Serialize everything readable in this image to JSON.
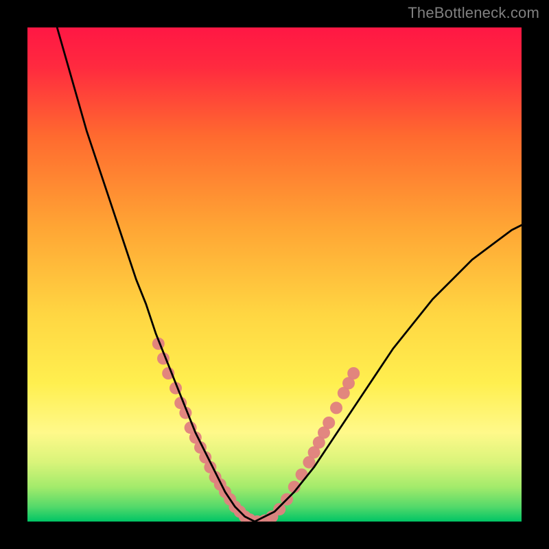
{
  "watermark": "TheBottleneck.com",
  "chart_data": {
    "type": "line",
    "title": "",
    "xlabel": "",
    "ylabel": "",
    "xlim": [
      0,
      100
    ],
    "ylim": [
      0,
      100
    ],
    "background_gradient": {
      "stops": [
        {
          "offset": 0.0,
          "color": "#ff1744"
        },
        {
          "offset": 0.08,
          "color": "#ff2a3f"
        },
        {
          "offset": 0.22,
          "color": "#ff6a2f"
        },
        {
          "offset": 0.4,
          "color": "#ffa434"
        },
        {
          "offset": 0.58,
          "color": "#ffd642"
        },
        {
          "offset": 0.72,
          "color": "#ffef4f"
        },
        {
          "offset": 0.82,
          "color": "#fff98a"
        },
        {
          "offset": 0.88,
          "color": "#d9f47a"
        },
        {
          "offset": 0.93,
          "color": "#a3eb6b"
        },
        {
          "offset": 0.97,
          "color": "#54d96a"
        },
        {
          "offset": 1.0,
          "color": "#00c565"
        }
      ]
    },
    "series": [
      {
        "name": "bottleneck-curve",
        "color": "#000000",
        "x": [
          6,
          8,
          10,
          12,
          14,
          16,
          18,
          20,
          22,
          24,
          26,
          28,
          30,
          32,
          34,
          36,
          38,
          40,
          42,
          44,
          46,
          50,
          54,
          58,
          62,
          66,
          70,
          74,
          78,
          82,
          86,
          90,
          94,
          98,
          100
        ],
        "y": [
          100,
          93,
          86,
          79,
          73,
          67,
          61,
          55,
          49,
          44,
          38,
          33,
          28,
          23,
          18,
          14,
          10,
          6,
          3,
          1,
          0,
          2,
          6,
          11,
          17,
          23,
          29,
          35,
          40,
          45,
          49,
          53,
          56,
          59,
          60
        ]
      }
    ],
    "overlay_points": {
      "name": "highlight-dots",
      "color": "#e08080",
      "radius": 9,
      "points": [
        {
          "x": 26.5,
          "y": 36
        },
        {
          "x": 27.5,
          "y": 33
        },
        {
          "x": 28.5,
          "y": 30
        },
        {
          "x": 30.0,
          "y": 27
        },
        {
          "x": 31.0,
          "y": 24
        },
        {
          "x": 32.0,
          "y": 22
        },
        {
          "x": 33.0,
          "y": 19
        },
        {
          "x": 34.0,
          "y": 17
        },
        {
          "x": 35.0,
          "y": 15
        },
        {
          "x": 36.0,
          "y": 13
        },
        {
          "x": 37.0,
          "y": 11
        },
        {
          "x": 38.0,
          "y": 9
        },
        {
          "x": 39.0,
          "y": 7.5
        },
        {
          "x": 40.0,
          "y": 6
        },
        {
          "x": 41.0,
          "y": 4.5
        },
        {
          "x": 42.0,
          "y": 3
        },
        {
          "x": 43.0,
          "y": 2
        },
        {
          "x": 44.0,
          "y": 1
        },
        {
          "x": 45.0,
          "y": 0.4
        },
        {
          "x": 46.5,
          "y": 0
        },
        {
          "x": 48.0,
          "y": 0.2
        },
        {
          "x": 49.5,
          "y": 1
        },
        {
          "x": 51.0,
          "y": 2.5
        },
        {
          "x": 52.5,
          "y": 4.5
        },
        {
          "x": 54.0,
          "y": 7
        },
        {
          "x": 55.5,
          "y": 9.5
        },
        {
          "x": 57.0,
          "y": 12
        },
        {
          "x": 58.0,
          "y": 14
        },
        {
          "x": 59.0,
          "y": 16
        },
        {
          "x": 60.0,
          "y": 18
        },
        {
          "x": 61.0,
          "y": 20
        },
        {
          "x": 62.5,
          "y": 23
        },
        {
          "x": 64.0,
          "y": 26
        },
        {
          "x": 65.0,
          "y": 28
        },
        {
          "x": 66.0,
          "y": 30
        }
      ]
    }
  }
}
